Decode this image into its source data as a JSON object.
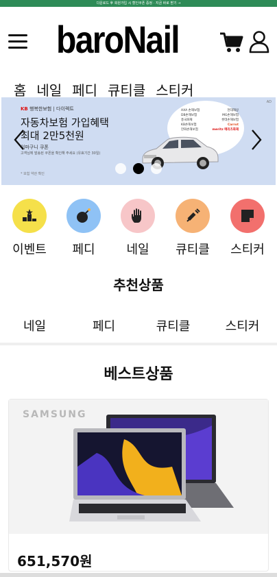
{
  "topbar": {
    "text": "다운로드 후 회원가입 시 할인쿠폰 증정 · 지금 바로 받기 →"
  },
  "header": {
    "logo": "baroNail",
    "menu_icon": "hamburger-menu-icon",
    "cart_icon": "shopping-cart-icon",
    "user_icon": "user-profile-icon"
  },
  "tabs": [
    {
      "label": "홈",
      "active": true
    },
    {
      "label": "네일"
    },
    {
      "label": "페디"
    },
    {
      "label": "큐티클"
    },
    {
      "label": "스티커"
    }
  ],
  "banner": {
    "brand_prefix": "KB",
    "brand_line": "행복한보험 | 다이렉트",
    "headline_1": "자동차보험 가입혜택",
    "headline_2": "최대 2만5천원",
    "sub_1": "이마구니 쿠폰",
    "sub_2": "고객님께 발송된 쿠폰을 확인해 주세요 (유효기간 30일)",
    "note": "* 보험 약관 확인",
    "ad_mark": "AD",
    "partners": [
      [
        "AXA 손해보험",
        "현대해상"
      ],
      [
        "DB손해보험",
        "MG손해보험"
      ],
      [
        "흥국화재",
        "롯데손해보험"
      ],
      [
        "KB손해보험",
        "Carrot"
      ],
      [
        "한화손해보험",
        "meritz 메리츠화재"
      ]
    ],
    "slides": 3,
    "active_slide": 2
  },
  "categories": [
    {
      "label": "이벤트",
      "icon": "event-podium-icon",
      "color": "#f5e04a"
    },
    {
      "label": "페디",
      "icon": "bomb-icon",
      "color": "#8fc2f5"
    },
    {
      "label": "네일",
      "icon": "hand-icon",
      "color": "#f7c6c8"
    },
    {
      "label": "큐티클",
      "icon": "syringe-icon",
      "color": "#f6b275"
    },
    {
      "label": "스티커",
      "icon": "sticky-note-icon",
      "color": "#f2706d"
    }
  ],
  "recommended": {
    "title": "추천상품",
    "tabs": [
      "네일",
      "페디",
      "큐티클",
      "스티커"
    ]
  },
  "best": {
    "title": "베스트상품",
    "product": {
      "brand": "SAMSUNG",
      "price": "651,570원"
    }
  }
}
